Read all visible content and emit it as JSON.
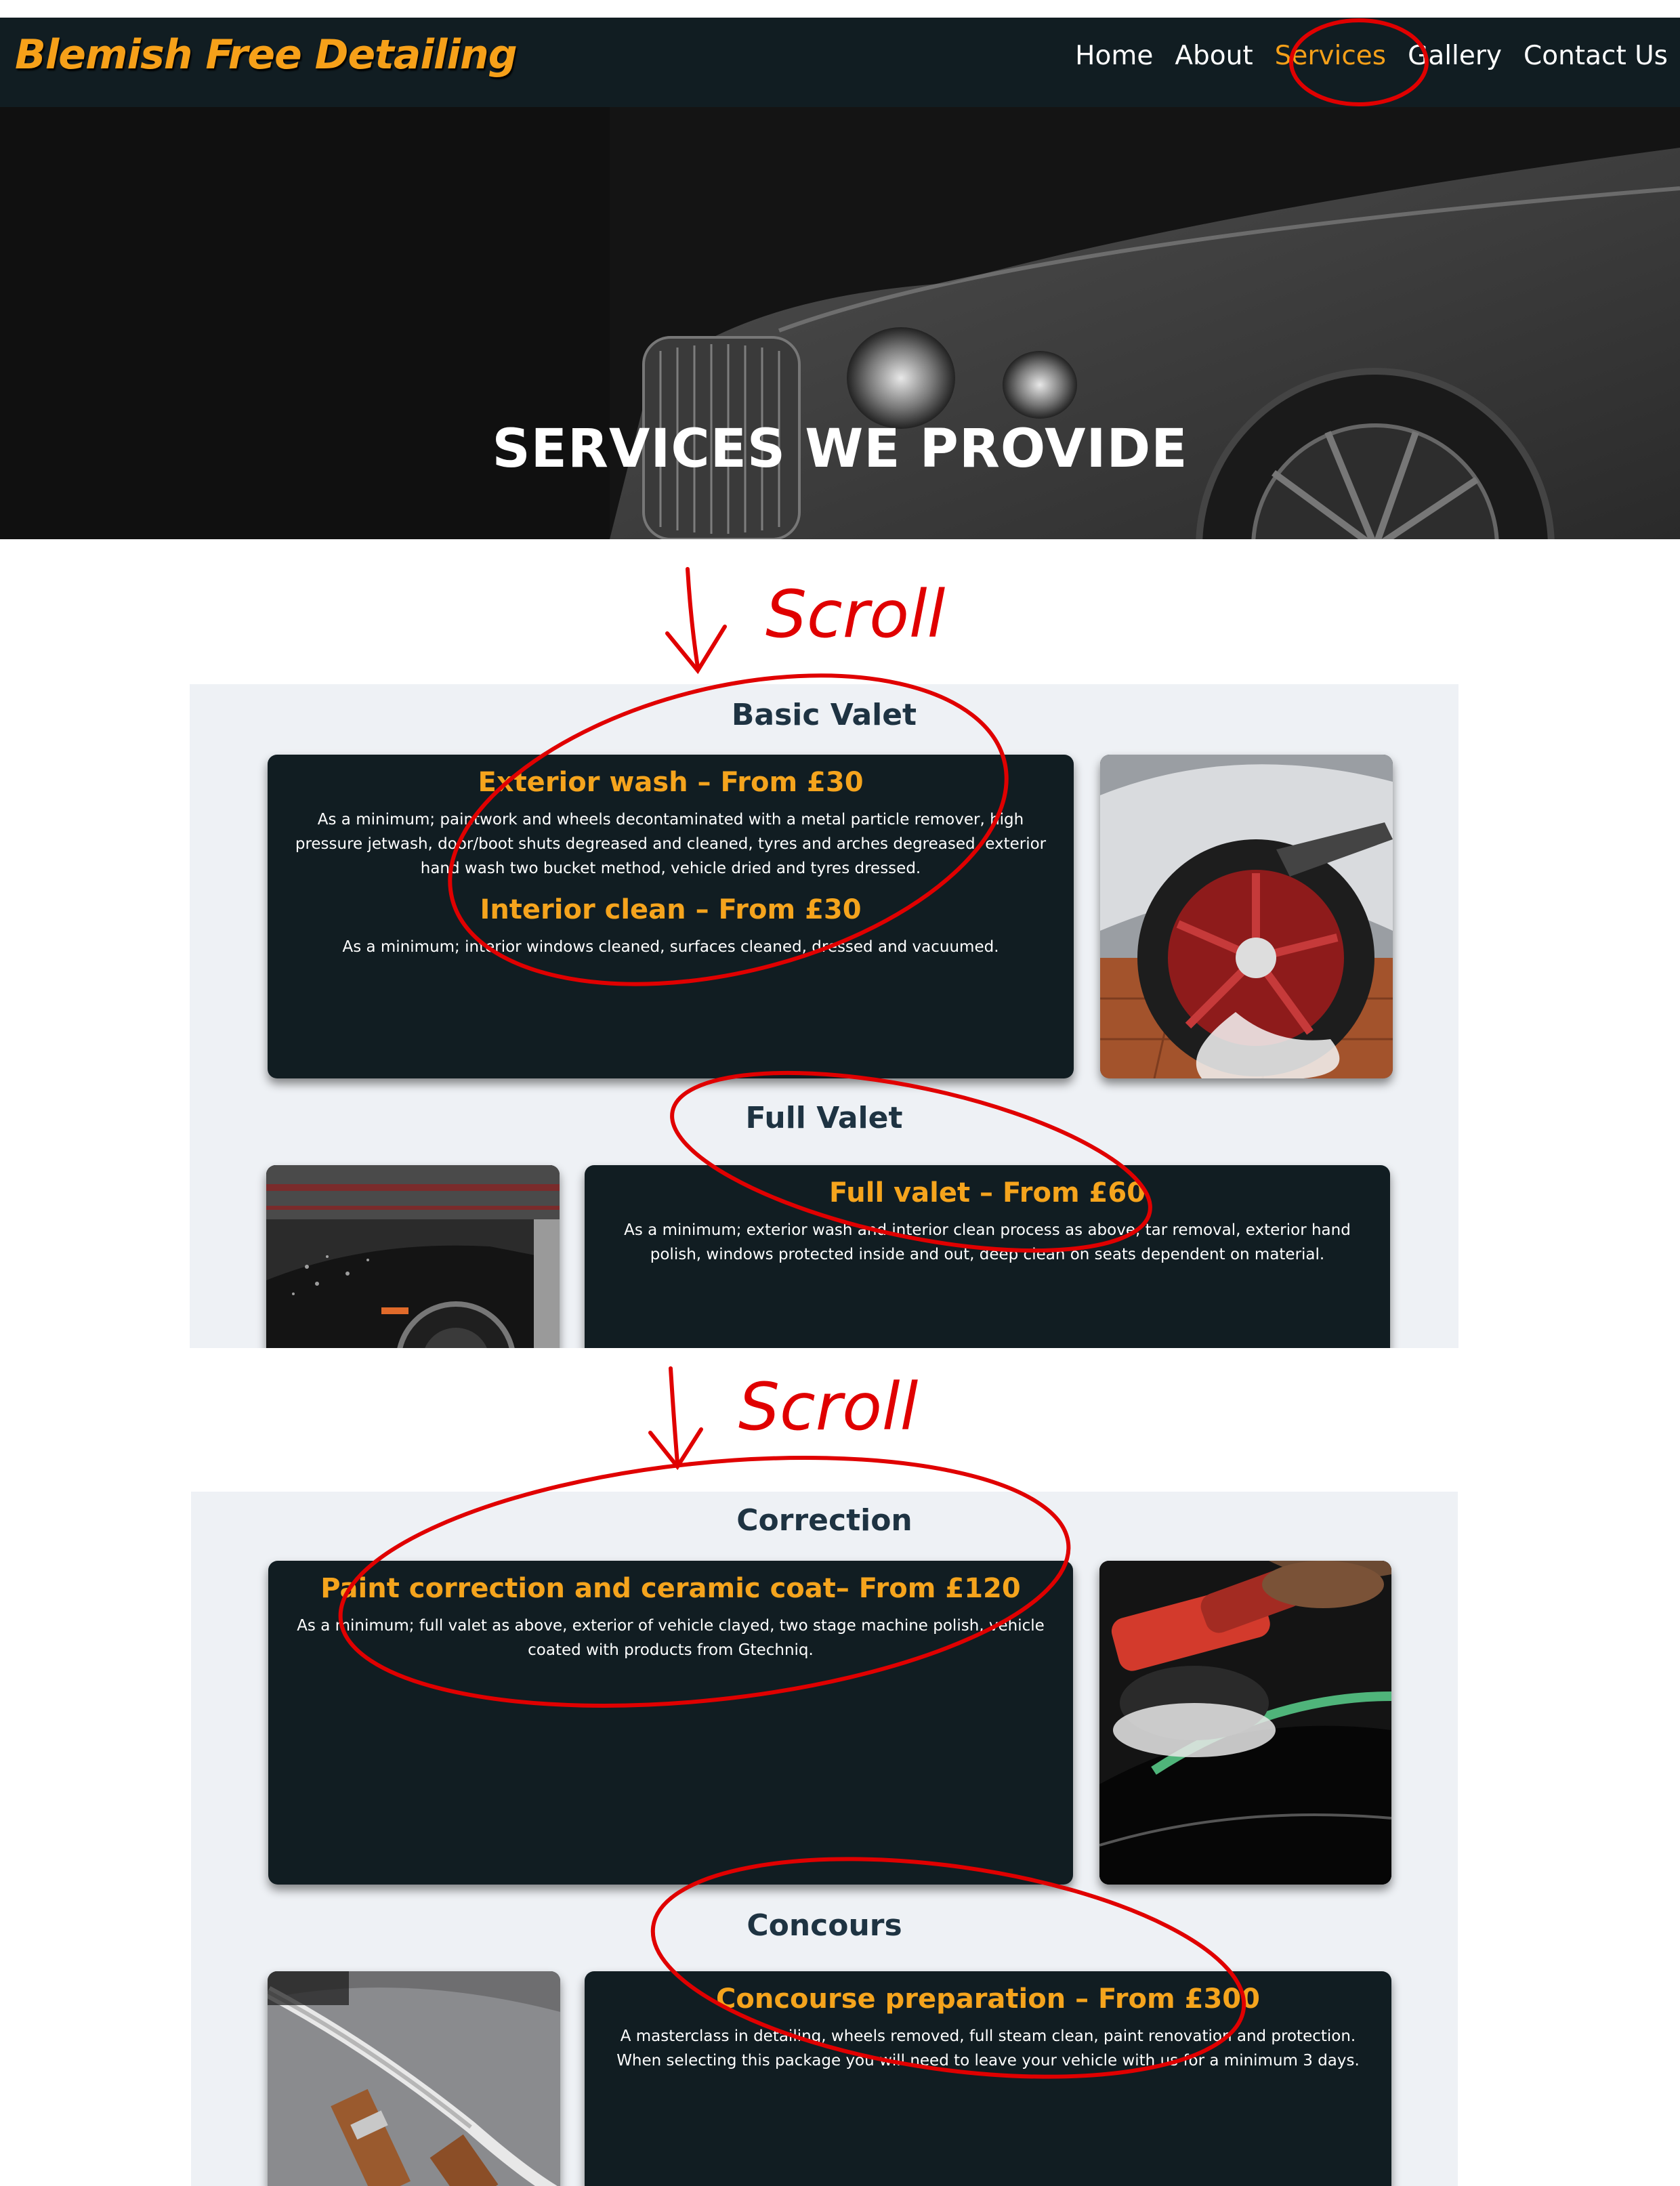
{
  "brand": {
    "name": "Blemish Free Detailing",
    "color": "#f6a019"
  },
  "nav": {
    "items": [
      {
        "label": "Home",
        "active": false
      },
      {
        "label": "About",
        "active": false
      },
      {
        "label": "Services",
        "active": true
      },
      {
        "label": "Gallery",
        "active": false
      },
      {
        "label": "Contact Us",
        "active": false
      }
    ]
  },
  "hero": {
    "title": "SERVICES WE PROVIDE"
  },
  "annotations": {
    "scroll_1": "Scroll",
    "scroll_2": "Scroll",
    "color": "#e00000"
  },
  "sections": {
    "basic_valet": {
      "heading": "Basic Valet",
      "exterior_title": "Exterior wash – From £30",
      "exterior_text": "As a minimum; paintwork and wheels decontaminated with a metal particle remover, high pressure jetwash, door/boot shuts degreased and cleaned, tyres and arches degreased, exterior hand wash two bucket method, vehicle dried and tyres dressed.",
      "interior_title": "Interior clean – From £30",
      "interior_text": "As a minimum; interior windows cleaned, surfaces cleaned, dressed and vacuumed.",
      "photo": "wheel-being-cleaned-photo"
    },
    "full_valet": {
      "heading": "Full Valet",
      "title": "Full valet – From £60",
      "text": "As a minimum; exterior wash and interior clean process as above, tar removal, exterior hand polish, windows protected inside and out, deep clean on seats dependent on material.",
      "photo": "car-jetwash-photo"
    },
    "correction": {
      "heading": "Correction",
      "title": "Paint correction and ceramic coat– From £120",
      "text": "As a minimum; full valet as above, exterior of vehicle clayed, two stage machine polish, vehicle coated with products from Gtechniq.",
      "photo": "machine-polisher-photo"
    },
    "concours": {
      "heading": "Concours",
      "title": "Concourse preparation – From £300",
      "text": "A masterclass in detailing, wheels removed, full steam clean, paint renovation and protection. When selecting this package you will need to leave your vehicle with us for a minimum 3 days.",
      "photo": "classic-car-strap-photo"
    }
  }
}
